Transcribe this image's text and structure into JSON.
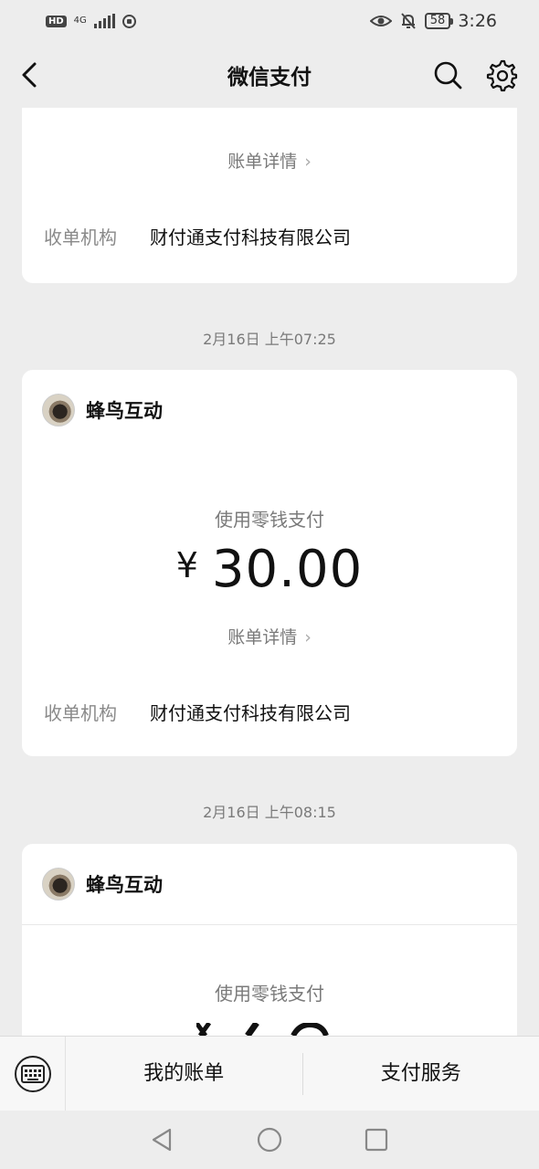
{
  "status_bar": {
    "hd_label": "HD",
    "network_label": "4G",
    "battery_level": "58",
    "time": "3:26"
  },
  "nav": {
    "title": "微信支付"
  },
  "cards": [
    {
      "detail_label": "账单详情",
      "acquirer_label": "收单机构",
      "acquirer_value": "财付通支付科技有限公司"
    },
    {
      "date": "2月16日 上午07:25",
      "merchant": "蜂鸟互动",
      "pay_method": "使用零钱支付",
      "currency_symbol": "¥",
      "amount": "30.00",
      "detail_label": "账单详情",
      "acquirer_label": "收单机构",
      "acquirer_value": "财付通支付科技有限公司"
    },
    {
      "date": "2月16日 上午08:15",
      "merchant": "蜂鸟互动",
      "pay_method": "使用零钱支付"
    }
  ],
  "bottom_bar": {
    "my_bills": "我的账单",
    "pay_services": "支付服务"
  },
  "icons": {
    "back": "chevron-left-icon",
    "search": "search-icon",
    "settings": "gear-icon",
    "keyboard": "keyboard-icon",
    "sys_back": "triangle-back-icon",
    "sys_home": "circle-home-icon",
    "sys_recent": "square-recent-icon"
  }
}
